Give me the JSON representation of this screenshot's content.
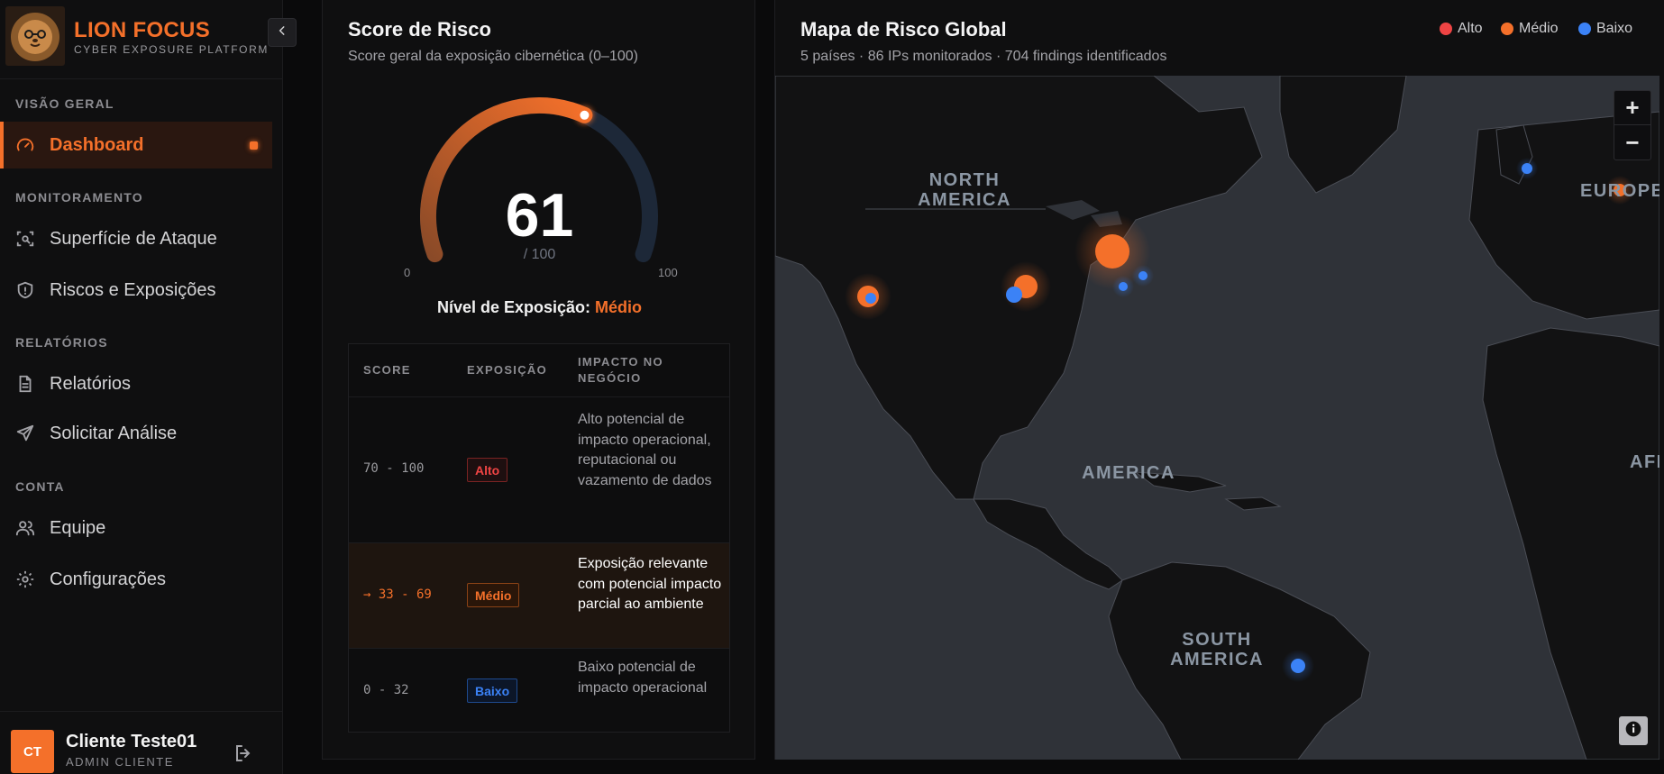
{
  "brand": {
    "title": "LION FOCUS",
    "subtitle": "CYBER EXPOSURE PLATFORM"
  },
  "sidebar": {
    "sections": [
      {
        "label": "VISÃO GERAL"
      },
      {
        "label": "MONITORAMENTO"
      },
      {
        "label": "RELATÓRIOS"
      },
      {
        "label": "CONTA"
      }
    ],
    "items": [
      {
        "label": "Dashboard",
        "icon": "gauge-icon",
        "active": true
      },
      {
        "label": "Superfície de Ataque",
        "icon": "scan-icon"
      },
      {
        "label": "Riscos e Exposições",
        "icon": "shield-icon"
      },
      {
        "label": "Relatórios",
        "icon": "document-icon"
      },
      {
        "label": "Solicitar Análise",
        "icon": "send-icon"
      },
      {
        "label": "Equipe",
        "icon": "users-icon"
      },
      {
        "label": "Configurações",
        "icon": "gear-icon"
      }
    ]
  },
  "user": {
    "initials": "CT",
    "name": "Cliente Teste01",
    "role": "ADMIN CLIENTE"
  },
  "score_panel": {
    "title": "Score de Risco",
    "subtitle": "Score geral da exposição cibernética (0–100)",
    "score": "61",
    "score_fraction": 0.61,
    "max_label": "/ 100",
    "min_tick": "0",
    "max_tick": "100",
    "exposure_prefix": "Nível de Exposição:",
    "exposure_level": "Médio",
    "table": {
      "headers": [
        "SCORE",
        "EXPOSIÇÃO",
        "IMPACTO NO NEGÓCIO"
      ],
      "rows": [
        {
          "range": "70 - 100",
          "badge": "Alto",
          "impact": "Alto potencial de impacto operacional, reputacional ou vazamento de dados"
        },
        {
          "range": "→ 33 - 69",
          "badge": "Médio",
          "impact": "Exposição relevante com potencial impacto parcial ao ambiente"
        },
        {
          "range": "0 - 32",
          "badge": "Baixo",
          "impact": "Baixo potencial de impacto operacional"
        }
      ]
    }
  },
  "map_panel": {
    "title": "Mapa de Risco Global",
    "subtitle": "5 países · 86 IPs monitorados · 704 findings identificados",
    "legend": [
      {
        "label": "Alto",
        "color": "#ef4444"
      },
      {
        "label": "Médio",
        "color": "#f4702a"
      },
      {
        "label": "Baixo",
        "color": "#3b82f6"
      }
    ],
    "zoom_in": "+",
    "zoom_out": "−",
    "labels": {
      "north_america": "NORTH AMERICA",
      "central_america": "AMERICA",
      "south_america": "SOUTH AMERICA",
      "europe": "EUROPE",
      "africa": "AFR"
    }
  },
  "colors": {
    "accent": "#f4702a",
    "alto": "#ef4444",
    "medio": "#f4702a",
    "baixo": "#3b82f6"
  }
}
